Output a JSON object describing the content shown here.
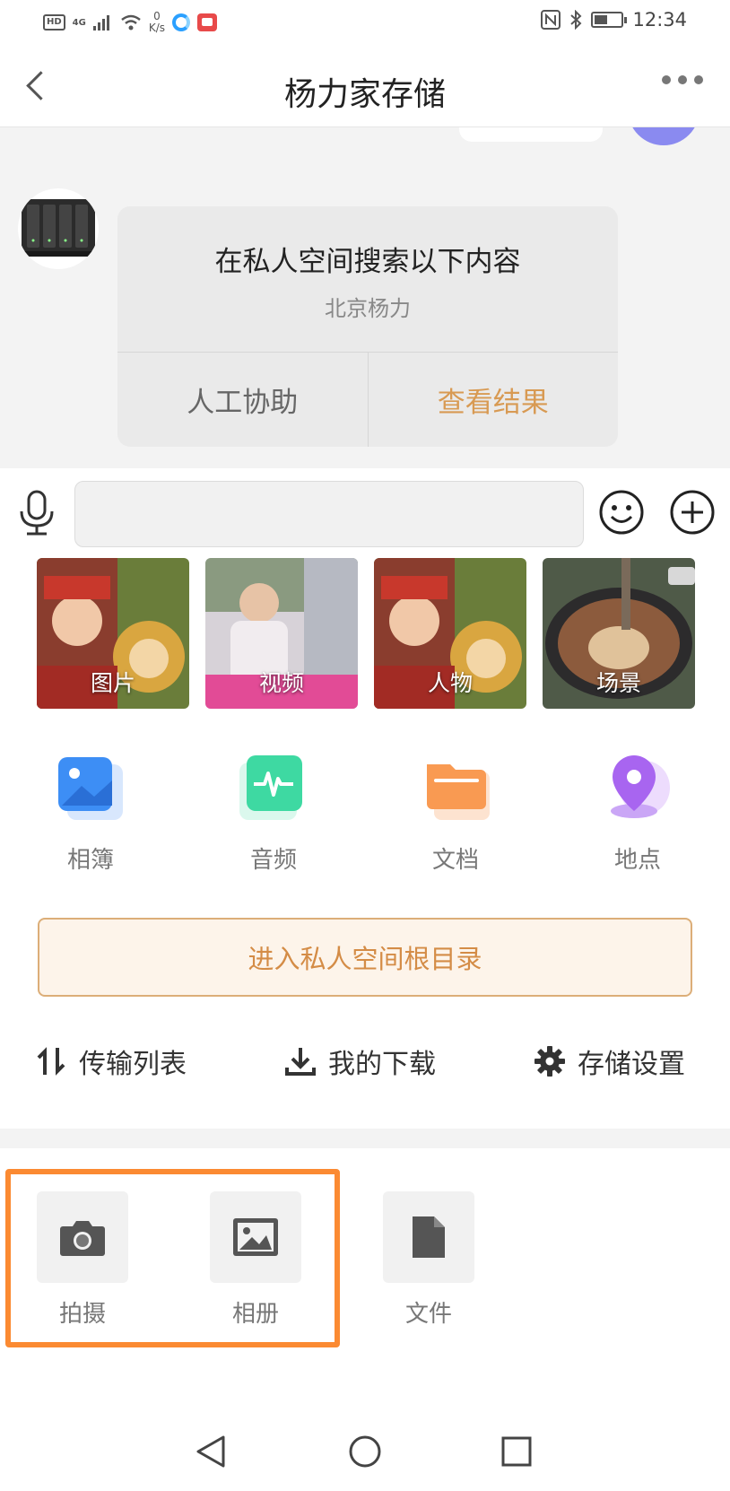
{
  "status_bar": {
    "hd": "HD",
    "network": "4G",
    "speed_value": "0",
    "speed_unit": "K/s",
    "time": "12:34"
  },
  "header": {
    "title": "杨力家存储"
  },
  "chat": {
    "card_title": "在私人空间搜索以下内容",
    "card_subtitle": "北京杨力",
    "help_label": "人工协助",
    "result_label": "查看结果"
  },
  "input_bar": {
    "placeholder": ""
  },
  "tiles": [
    {
      "label": "图片"
    },
    {
      "label": "视频"
    },
    {
      "label": "人物"
    },
    {
      "label": "场景"
    }
  ],
  "categories": [
    {
      "label": "相簿",
      "icon": "photo-album-icon",
      "color": "#3d8ef5"
    },
    {
      "label": "音频",
      "icon": "audio-wave-icon",
      "color": "#3ed9a2"
    },
    {
      "label": "文档",
      "icon": "folder-icon",
      "color": "#f99a52"
    },
    {
      "label": "地点",
      "icon": "location-pin-icon",
      "color": "#a865f0"
    }
  ],
  "root_button": {
    "label": "进入私人空间根目录"
  },
  "tools": [
    {
      "label": "传输列表",
      "icon": "transfer-icon"
    },
    {
      "label": "我的下载",
      "icon": "download-icon"
    },
    {
      "label": "存储设置",
      "icon": "gear-icon"
    }
  ],
  "attach": [
    {
      "label": "拍摄",
      "icon": "camera-icon"
    },
    {
      "label": "相册",
      "icon": "image-icon"
    },
    {
      "label": "文件",
      "icon": "file-icon"
    }
  ],
  "colors": {
    "accent": "#d89a53",
    "highlight": "#fb8a32"
  }
}
